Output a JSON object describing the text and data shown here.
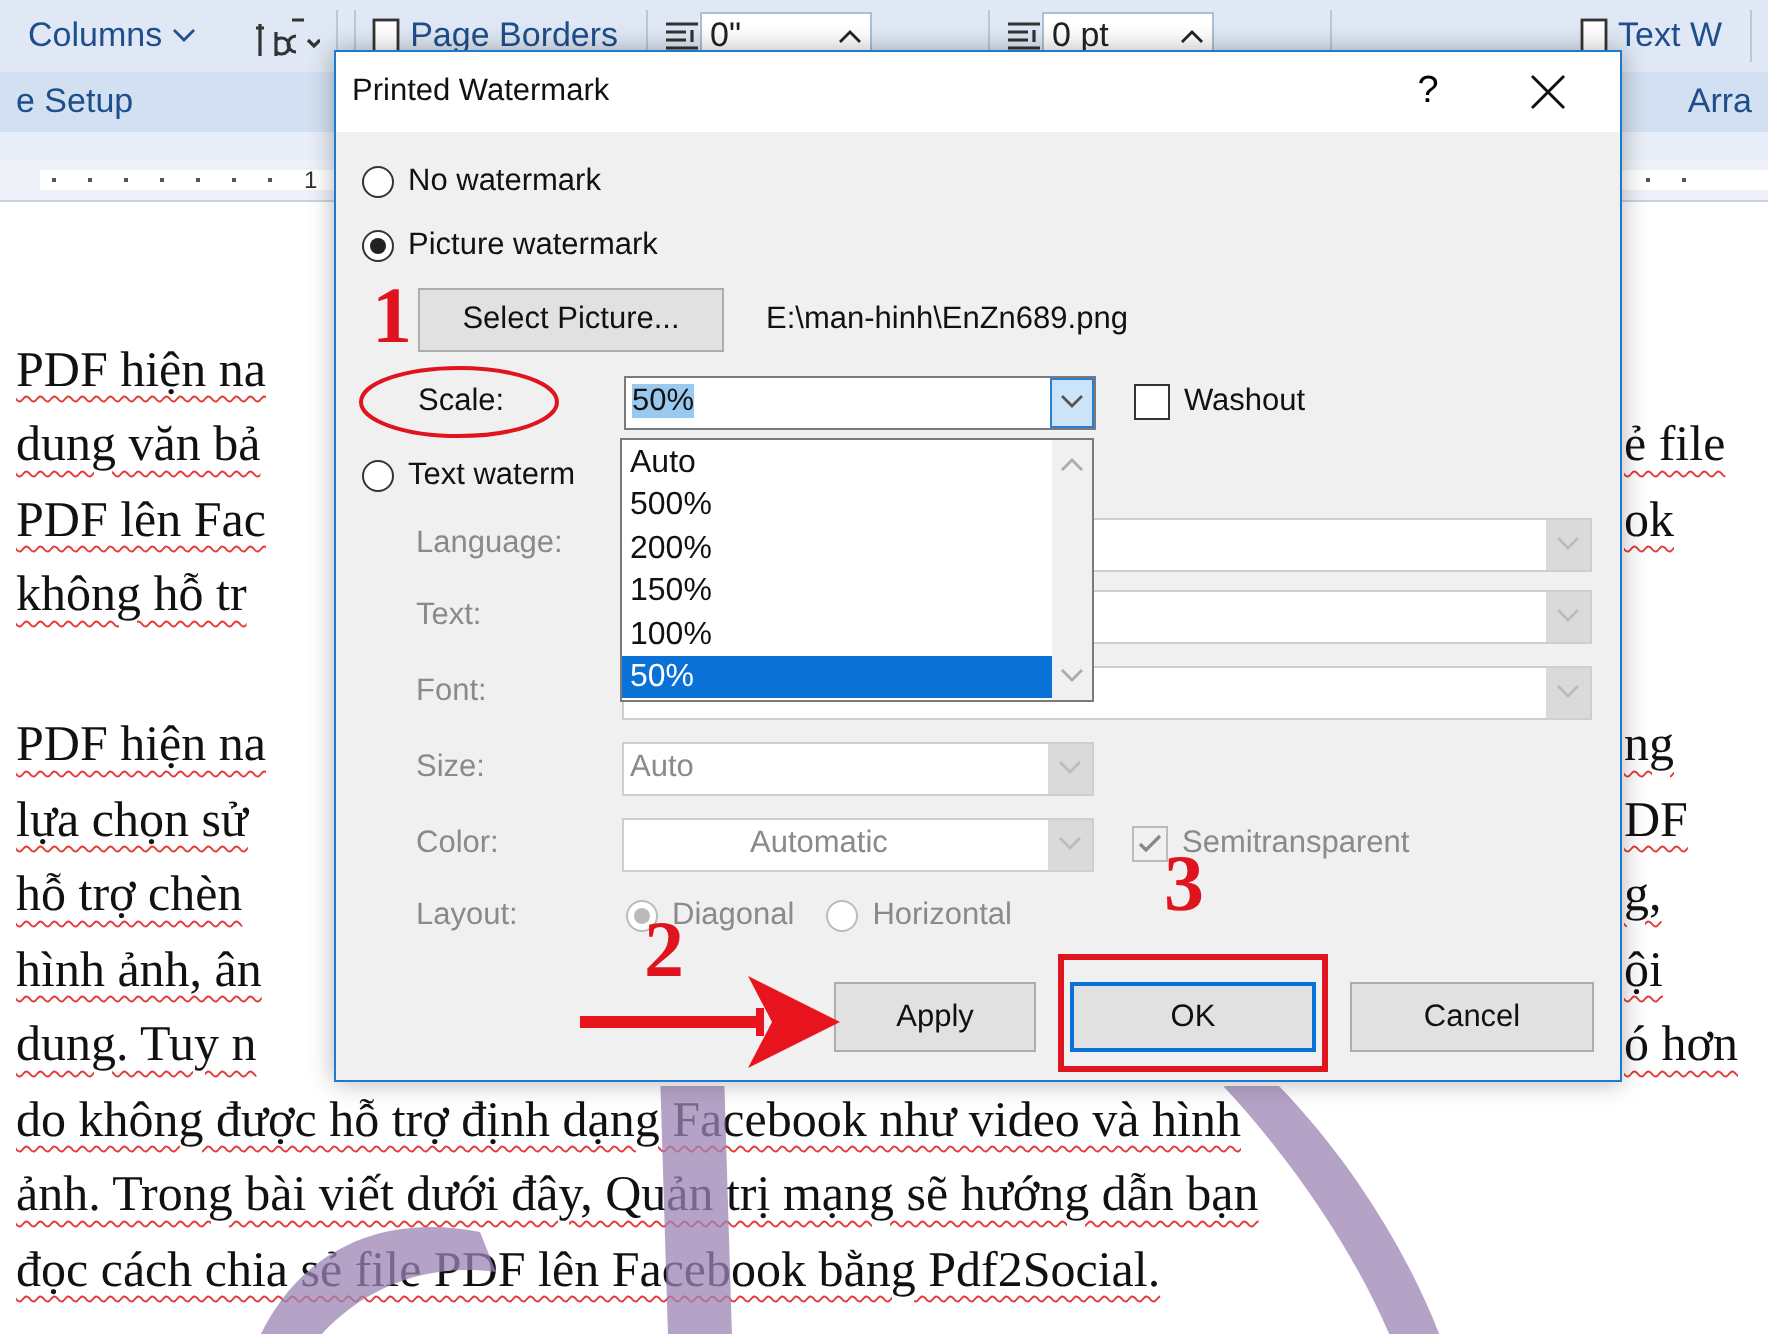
{
  "ribbon": {
    "items": [
      {
        "kind": "dropdown",
        "label": "Columns"
      },
      {
        "kind": "hyphenation"
      },
      {
        "kind": "button",
        "label": "Page Borders"
      },
      {
        "kind": "spin",
        "value": "0\""
      },
      {
        "kind": "spin",
        "value": "0 pt"
      },
      {
        "kind": "button",
        "label": "Text W"
      }
    ],
    "group_labels": [
      "e Setup",
      "Arra"
    ]
  },
  "ruler": {
    "number": "1"
  },
  "document": {
    "paragraphs": [
      {
        "lines": [
          {
            "left": "PDF hiện na"
          },
          {
            "left": "dung văn bả",
            "right": "ẻ file"
          },
          {
            "left": "PDF lên Fac",
            "right": "ok"
          },
          {
            "left": "không hỗ tr"
          }
        ]
      },
      {
        "lines": [
          {
            "left": "PDF hiện na",
            "right": "ng"
          },
          {
            "left": "lựa chọn sử",
            "right": "DF"
          },
          {
            "left": "hỗ trợ chèn",
            "right": "g,"
          },
          {
            "left": "hình ảnh, ân",
            "right": "ội"
          },
          {
            "left": "dung. Tuy n",
            "right": "ó hơn"
          },
          {
            "left": "do không được hỗ trợ định dạng Facebook như video và hình"
          },
          {
            "left": "ảnh. Trong bài viết dưới đây, Quản trị mạng sẽ hướng dẫn bạn"
          },
          {
            "left": "đọc cách chia sẻ file PDF lên Facebook bằng Pdf2Social."
          }
        ]
      }
    ]
  },
  "dialog": {
    "title": "Printed Watermark",
    "help": "?",
    "options": [
      {
        "label": "No watermark",
        "selected": false
      },
      {
        "label": "Picture watermark",
        "selected": true
      },
      {
        "label": "Text waterm",
        "selected": false
      }
    ],
    "select_picture_button": "Select Picture...",
    "picture_path": "E:\\man-hinh\\EnZn689.png",
    "scale": {
      "label": "Scale:",
      "value": "50%",
      "expanded": true,
      "list": [
        {
          "label": "Auto",
          "selected": false
        },
        {
          "label": "500%",
          "selected": false
        },
        {
          "label": "200%",
          "selected": false
        },
        {
          "label": "150%",
          "selected": false
        },
        {
          "label": "100%",
          "selected": false
        },
        {
          "label": "50%",
          "selected": true
        }
      ]
    },
    "washout": {
      "label": "Washout",
      "checked": false
    },
    "text_watermark": {
      "disabled": true,
      "fields": [
        {
          "kind": "long",
          "label": "Language:"
        },
        {
          "kind": "long",
          "label": "Text:"
        },
        {
          "kind": "long",
          "label": "Font:"
        },
        {
          "kind": "short",
          "label": "Size:",
          "value": "Auto"
        },
        {
          "kind": "color",
          "label": "Color:",
          "value": "Automatic"
        }
      ],
      "semitransparent": {
        "label": "Semitransparent",
        "checked": true
      },
      "layout": {
        "label": "Layout:",
        "options": [
          {
            "label": "Diagonal",
            "selected": true
          },
          {
            "label": "Horizontal",
            "selected": false
          }
        ]
      }
    },
    "buttons": [
      {
        "label": "Apply",
        "focused": false
      },
      {
        "label": "OK",
        "focused": true
      },
      {
        "label": "Cancel",
        "focused": false
      }
    ]
  },
  "annotations": {
    "step_labels": [
      "1",
      "2",
      "3"
    ]
  }
}
